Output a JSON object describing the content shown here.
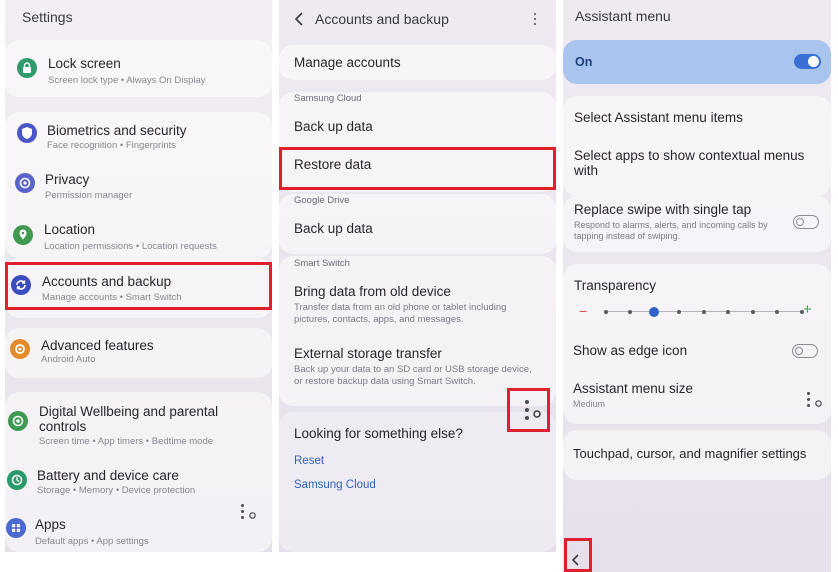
{
  "settings": {
    "title": "Settings",
    "items": [
      {
        "title": "Lock screen",
        "sub": "Screen lock type  •  Always On Display",
        "icon": "lock-icon",
        "color": "#2f9a6b"
      },
      {
        "title": "Biometrics and security",
        "sub": "Face recognition  •  Fingerprints",
        "icon": "shield-icon",
        "color": "#4a55c8"
      },
      {
        "title": "Privacy",
        "sub": "Permission manager",
        "icon": "privacy-icon",
        "color": "#5a64c8"
      },
      {
        "title": "Location",
        "sub": "Location permissions  •  Location requests",
        "icon": "location-icon",
        "color": "#3f9a4f"
      },
      {
        "title": "Accounts and backup",
        "sub": "Manage accounts  •  Smart Switch",
        "icon": "sync-icon",
        "color": "#3b4cc0"
      },
      {
        "title": "Advanced features",
        "sub": "Android Auto",
        "icon": "gear-plus-icon",
        "color": "#e48a2a"
      },
      {
        "title": "Digital Wellbeing and parental controls",
        "sub": "Screen time  •  App timers  •  Bedtime mode",
        "icon": "wellbeing-icon",
        "color": "#3d9a52"
      },
      {
        "title": "Battery and device care",
        "sub": "Storage  •  Memory  •  Device protection",
        "icon": "device-care-icon",
        "color": "#2a9a6a"
      },
      {
        "title": "Apps",
        "sub": "Default apps  •  App settings",
        "icon": "apps-icon",
        "color": "#4a6ad0"
      }
    ]
  },
  "accounts": {
    "title": "Accounts and backup",
    "manage_accounts": "Manage accounts",
    "samsung_cloud_header": "Samsung Cloud",
    "backup_cloud": "Back up data",
    "restore": "Restore data",
    "google_drive_header": "Google Drive",
    "backup_drive": "Back up data",
    "smart_switch_header": "Smart Switch",
    "bring_title": "Bring data from old device",
    "bring_sub": "Transfer data from an old phone or tablet including pictures, contacts, apps, and messages.",
    "external_title": "External storage transfer",
    "external_sub": "Back up your data to an SD card or USB storage device, or restore backup data using Smart Switch.",
    "looking": "Looking for something else?",
    "reset_link": "Reset",
    "cloud_link": "Samsung Cloud"
  },
  "assistant": {
    "title": "Assistant menu",
    "on_label": "On",
    "select_items": "Select Assistant menu items",
    "select_apps": "Select apps to show contextual menus with",
    "replace_title": "Replace swipe with single tap",
    "replace_sub": "Respond to alarms, alerts, and incoming calls by tapping instead of swiping.",
    "transparency": "Transparency",
    "transparency_level_step": 2,
    "transparency_steps": 9,
    "edge_icon": "Show as edge icon",
    "size_title": "Assistant menu size",
    "size_value": "Medium",
    "touchpad": "Touchpad, cursor, and magnifier settings"
  },
  "colors": {
    "highlight": "#e0202e",
    "accent": "#3b6fd8",
    "link": "#2f63c0"
  }
}
